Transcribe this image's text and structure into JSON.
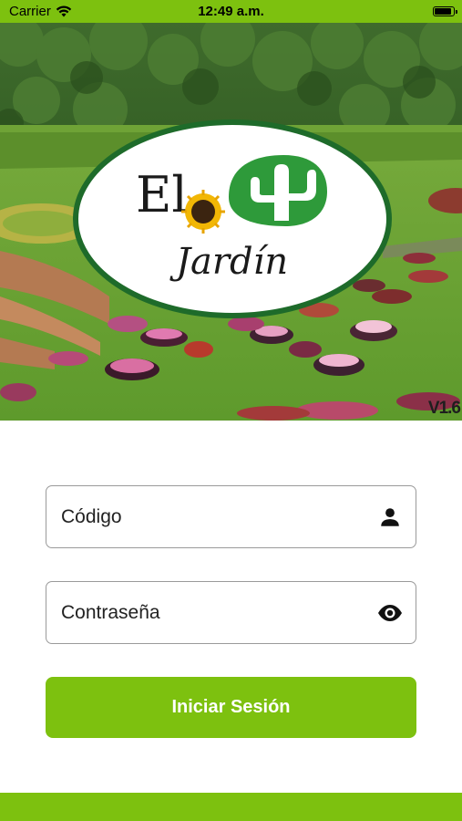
{
  "status_bar": {
    "carrier": "Carrier",
    "time": "12:49 a.m.",
    "battery_level": 0.9,
    "wifi_icon": "wifi-icon",
    "battery_icon": "battery-icon"
  },
  "header": {
    "logo_text_top": "El",
    "logo_text_bottom": "Jardín",
    "version": "V1.6"
  },
  "form": {
    "username": {
      "placeholder": "Código",
      "value": "",
      "icon": "person-icon"
    },
    "password": {
      "placeholder": "Contraseña",
      "value": "",
      "icon": "eye-icon"
    },
    "submit_label": "Iniciar Sesión"
  },
  "colors": {
    "brand_green": "#7dc10f",
    "logo_dark_green": "#1e6b2a",
    "logo_cactus_green": "#2e9a3a"
  }
}
